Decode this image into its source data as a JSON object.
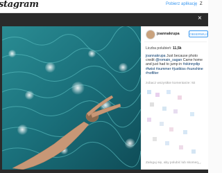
{
  "topbar": {
    "logo_text": "stagram",
    "get_app_label": "Pobierz aplikację",
    "signup_label": "Z"
  },
  "post": {
    "username": "joannakrupa",
    "follow_label": "OBSERWUJ",
    "likes_label": "Liczba polubień:",
    "likes_count": "11,5k",
    "caption_user": "joannakrupa",
    "caption_text": "Just because photo credit",
    "caption_line2": "Came home and just had to jump in",
    "caption_credit": "@romain_sagan",
    "hashtags": [
      "#skinnydip",
      "#twist",
      "#summer",
      "#justkiss",
      "#sunshine",
      "#nofilter"
    ],
    "view_comments": "zobacz wszystkie komentarze: 92",
    "login_text": "Zaloguj się, aby polubić lub skomen...",
    "more_dots": "..."
  },
  "colors": {
    "accent": "#3897f0",
    "link": "#003569",
    "water_dark": "#0f4c57",
    "water_light": "#4fb7b8"
  },
  "icons": [
    "close-icon"
  ]
}
